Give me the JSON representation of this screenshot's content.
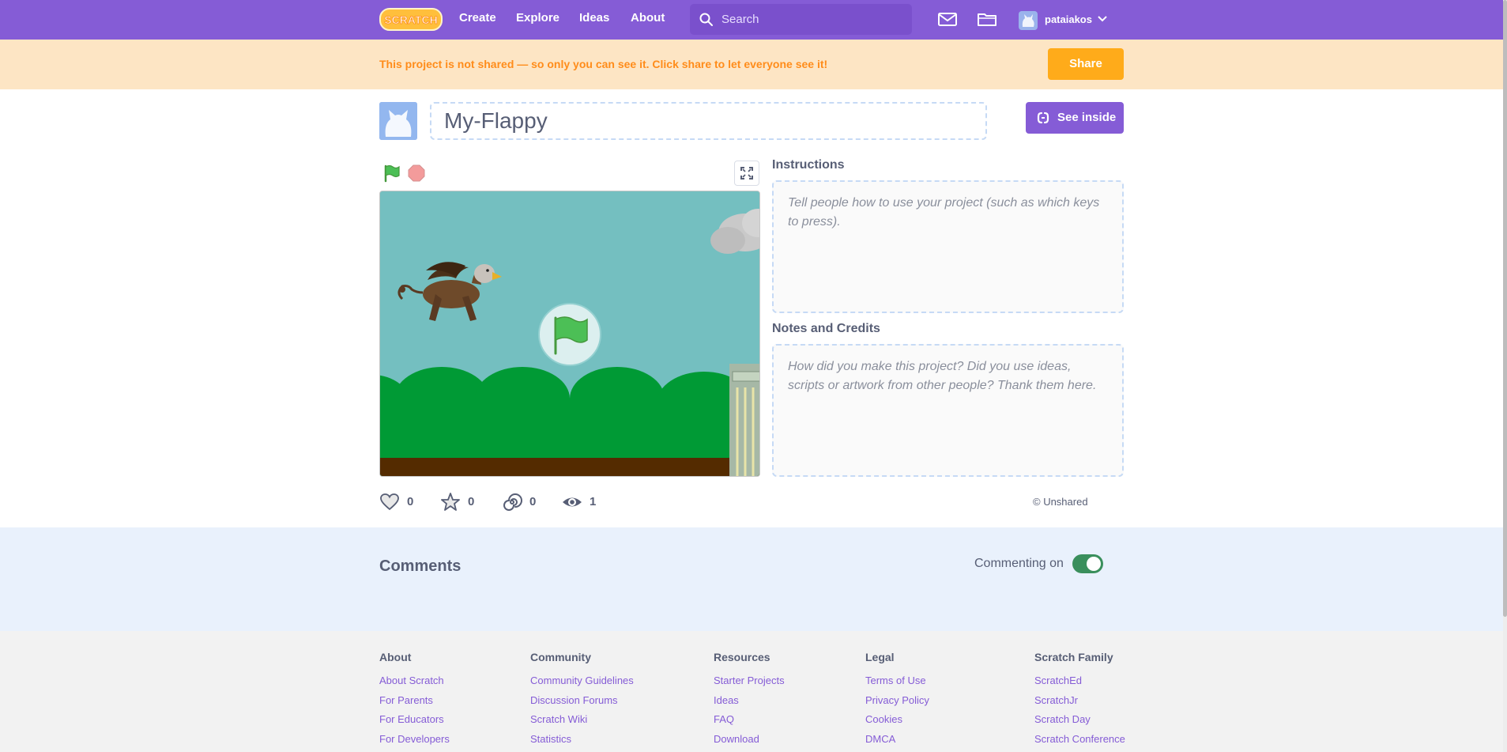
{
  "colors": {
    "nav_purple": "#855cd6",
    "banner_bg": "#fde5c4",
    "banner_text": "#ff8c1a",
    "share_orange": "#ffab1a",
    "comments_bg": "#e9f1fc",
    "footer_bg": "#f2f2f2",
    "toggle_green": "#3a8f5c"
  },
  "nav": {
    "logo_text": "SCRATCH",
    "links": [
      "Create",
      "Explore",
      "Ideas",
      "About"
    ],
    "search_placeholder": "Search",
    "icons": [
      "search-icon",
      "messages-icon",
      "my-stuff-folder-icon",
      "chevron-down-icon"
    ],
    "username": "pataiakos"
  },
  "banner": {
    "text": "This project is not shared — so only you can see it. Click share to let everyone see it!",
    "share_label": "Share"
  },
  "project": {
    "title": "My-Flappy",
    "see_inside_label": "See inside"
  },
  "player": {
    "icons": [
      "green-flag-icon",
      "stop-icon",
      "fullscreen-icon",
      "big-green-flag-icon"
    ]
  },
  "instructions": {
    "heading": "Instructions",
    "placeholder": "Tell people how to use your project (such as which keys to press)."
  },
  "notes": {
    "heading": "Notes and Credits",
    "placeholder": "How did you make this project? Did you use ideas, scripts or artwork from other people? Thank them here."
  },
  "stats": {
    "loves": "0",
    "favorites": "0",
    "remixes": "0",
    "views": "1",
    "license": "© Unshared"
  },
  "comments": {
    "title": "Comments",
    "commenting_label": "Commenting on",
    "commenting_enabled": true
  },
  "footer": {
    "columns": [
      {
        "title": "About",
        "links": [
          "About Scratch",
          "For Parents",
          "For Educators",
          "For Developers"
        ]
      },
      {
        "title": "Community",
        "links": [
          "Community Guidelines",
          "Discussion Forums",
          "Scratch Wiki",
          "Statistics"
        ]
      },
      {
        "title": "Resources",
        "links": [
          "Starter Projects",
          "Ideas",
          "FAQ",
          "Download"
        ]
      },
      {
        "title": "Legal",
        "links": [
          "Terms of Use",
          "Privacy Policy",
          "Cookies",
          "DMCA"
        ]
      },
      {
        "title": "Scratch Family",
        "links": [
          "ScratchEd",
          "ScratchJr",
          "Scratch Day",
          "Scratch Conference"
        ]
      }
    ]
  }
}
